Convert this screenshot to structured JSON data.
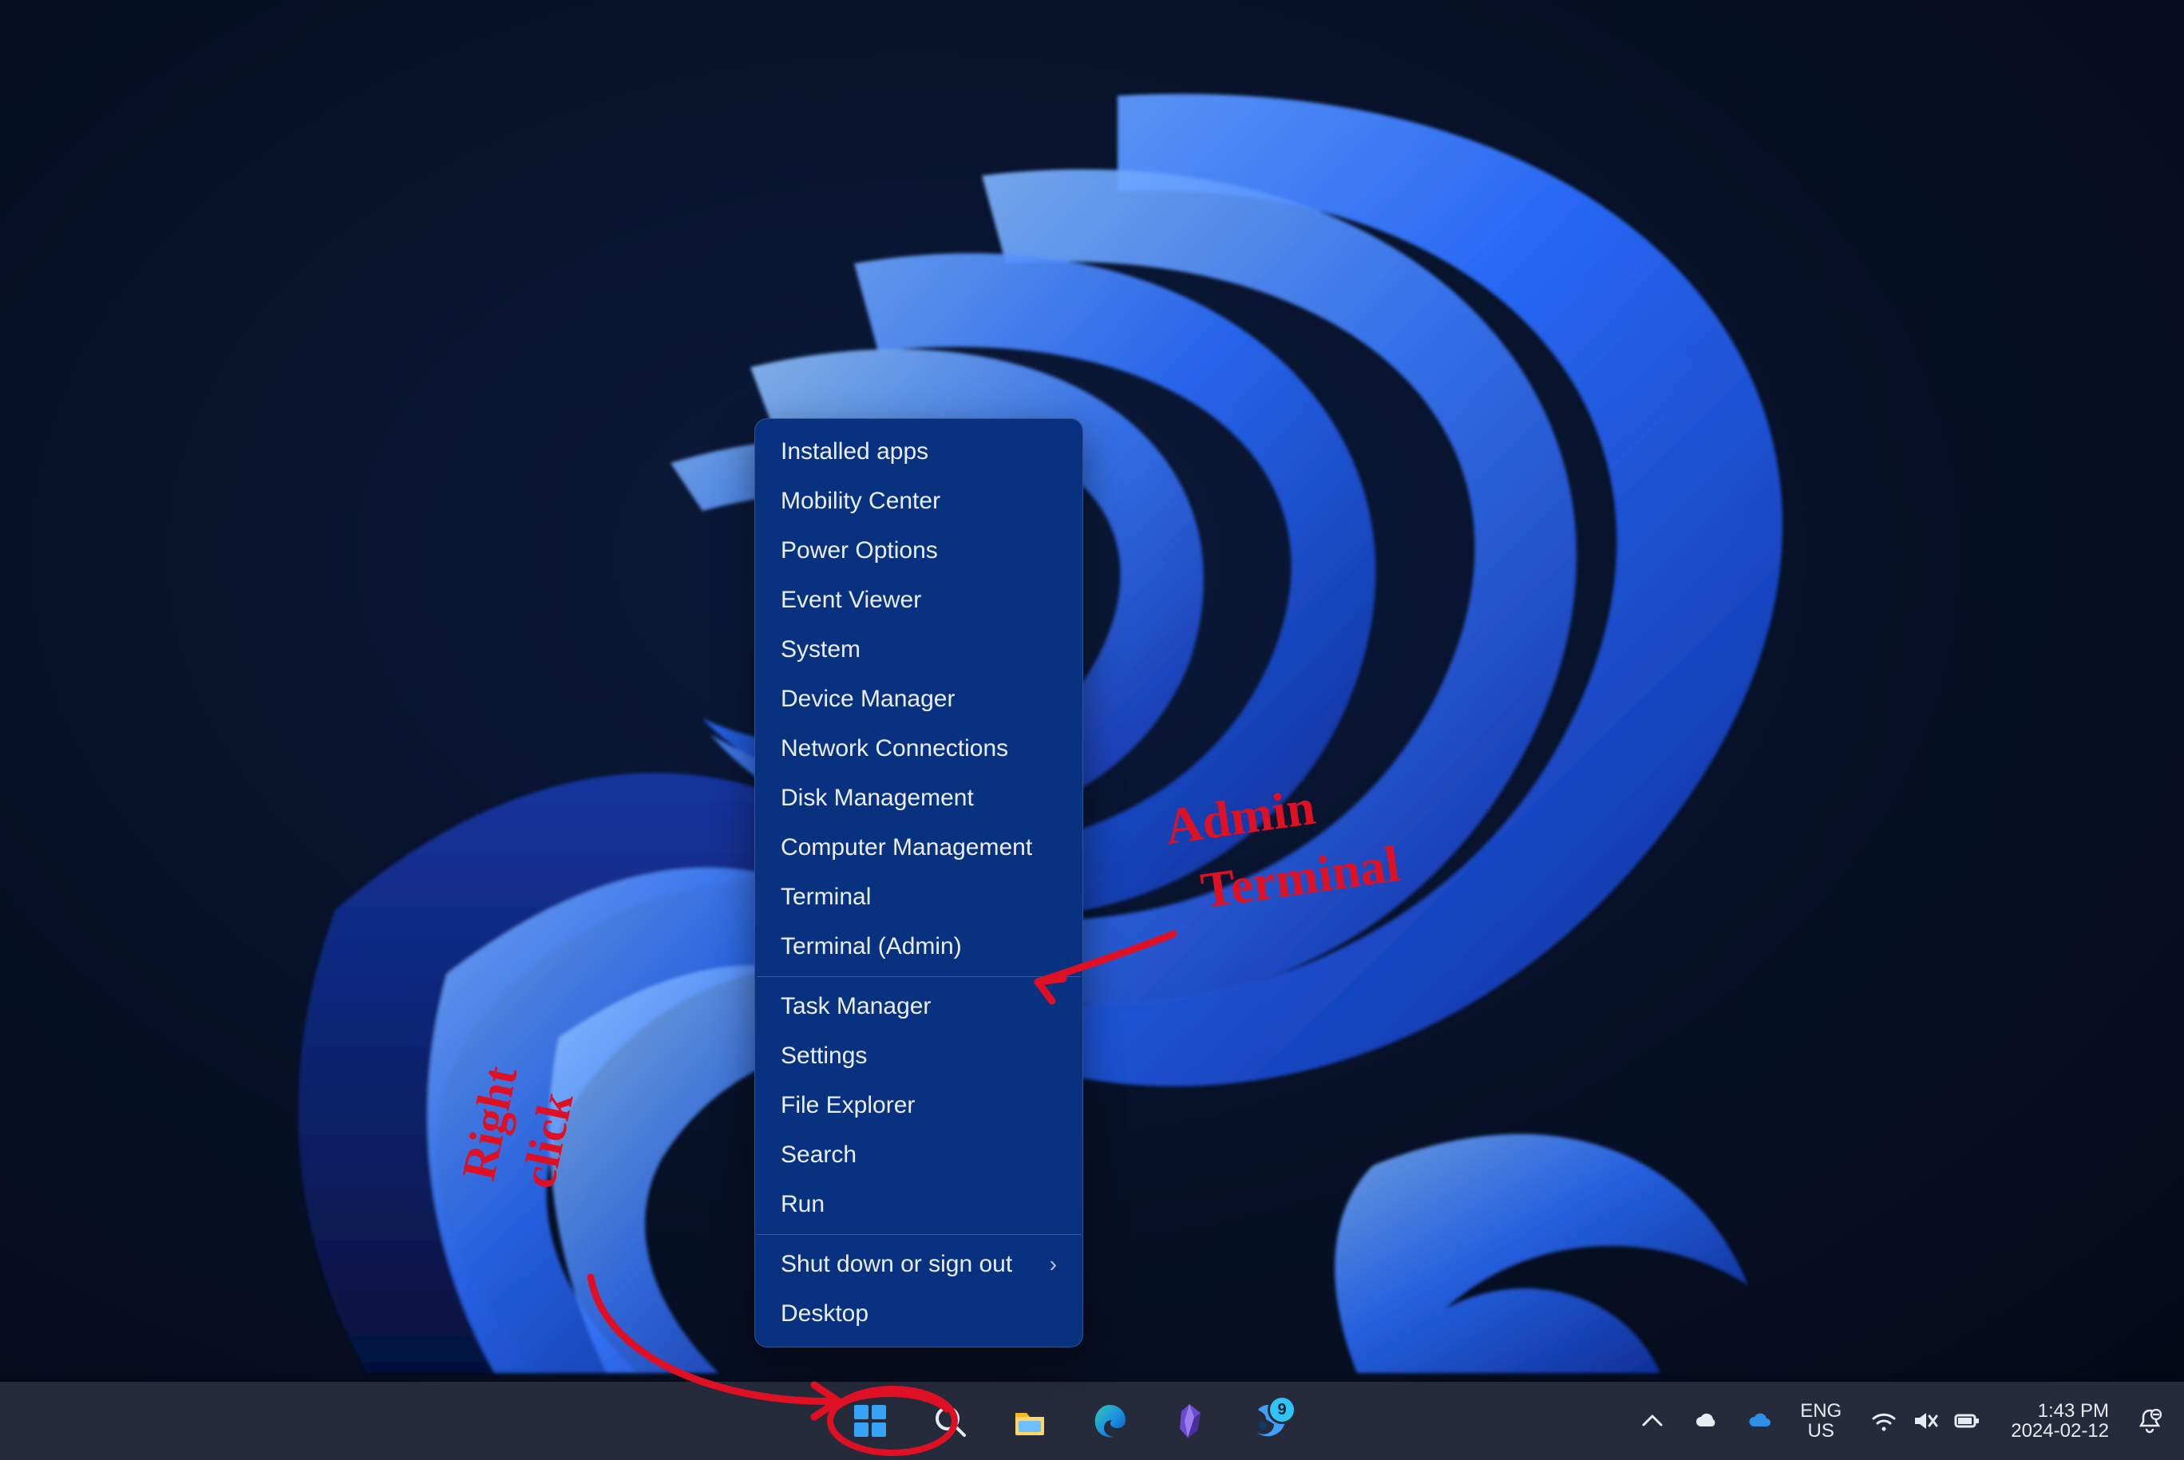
{
  "context_menu": {
    "groups": [
      [
        "Installed apps",
        "Mobility Center",
        "Power Options",
        "Event Viewer",
        "System",
        "Device Manager",
        "Network Connections",
        "Disk Management",
        "Computer Management",
        "Terminal",
        "Terminal (Admin)"
      ],
      [
        "Task Manager",
        "Settings",
        "File Explorer",
        "Search",
        "Run"
      ],
      [
        "Shut down or sign out",
        "Desktop"
      ]
    ],
    "submenu_items": [
      "Shut down or sign out"
    ]
  },
  "taskbar": {
    "pinned": [
      {
        "id": "start",
        "title": "Start"
      },
      {
        "id": "search",
        "title": "Search"
      },
      {
        "id": "file-explorer",
        "title": "File Explorer"
      },
      {
        "id": "edge",
        "title": "Microsoft Edge"
      },
      {
        "id": "obsidian",
        "title": "Obsidian"
      },
      {
        "id": "steam",
        "title": "Steam",
        "badge": "9"
      }
    ]
  },
  "systray": {
    "overflow": true,
    "cloud_weather": true,
    "onedrive": true,
    "language": {
      "line1": "ENG",
      "line2": "US"
    },
    "wifi": true,
    "volume_muted": true,
    "battery": true,
    "clock": {
      "time": "1:43 PM",
      "date": "2024-02-12"
    },
    "notifications": true
  },
  "annotations": {
    "admin_terminal_line1": "Admin",
    "admin_terminal_line2": "Terminal",
    "right_click_line1": "Right",
    "right_click_line2": "click"
  }
}
